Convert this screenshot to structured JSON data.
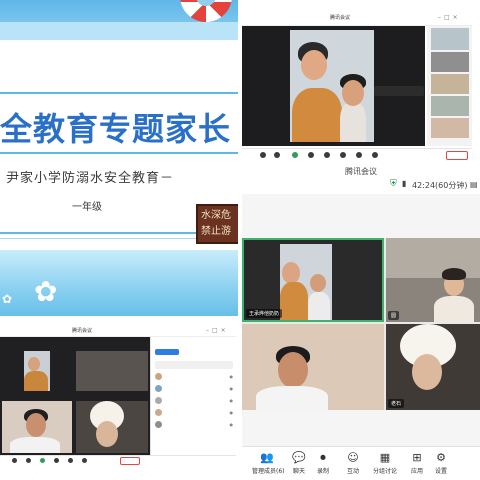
{
  "slide": {
    "title": "全教育专题家长",
    "subtitle": "尹家小学防溺水安全教育－",
    "grade": "一年级",
    "sign_line1": "水深危",
    "sign_line2": "禁止游"
  },
  "window_top_right": {
    "title": "腾讯会议",
    "main_tag": "",
    "speaker_label": "",
    "side_participants": [
      "",
      "",
      "",
      "",
      "",
      ""
    ],
    "end_label": ""
  },
  "window_bottom_left": {
    "title": "腾讯会议",
    "panel_header": "",
    "participants": [
      "",
      "",
      "",
      "",
      ""
    ],
    "end_label": ""
  },
  "window_bottom_right": {
    "app_title": "腾讯会议",
    "timer": "42:24(60分钟)",
    "tile_names": [
      "王承烨他奶奶",
      "圆",
      "",
      "老石"
    ],
    "bottom_bar": [
      {
        "icon": "participants-icon",
        "symbol": "👥",
        "label": "管理成员(6)"
      },
      {
        "icon": "chat-icon",
        "symbol": "💬",
        "label": "聊天"
      },
      {
        "icon": "record-icon",
        "symbol": "⏺",
        "label": "录制"
      },
      {
        "icon": "interaction-icon",
        "symbol": "☺",
        "label": "互动"
      },
      {
        "icon": "breakout-icon",
        "symbol": "▦",
        "label": "分组讨论"
      },
      {
        "icon": "apps-icon",
        "symbol": "⊞",
        "label": "应用"
      },
      {
        "icon": "settings-icon",
        "symbol": "⚙",
        "label": "设置"
      }
    ]
  },
  "colors": {
    "slide_title": "#2a70c9",
    "slide_band": "#5fb7e8",
    "meeting_dark": "#1d1d1f",
    "end_red": "#e54545"
  }
}
